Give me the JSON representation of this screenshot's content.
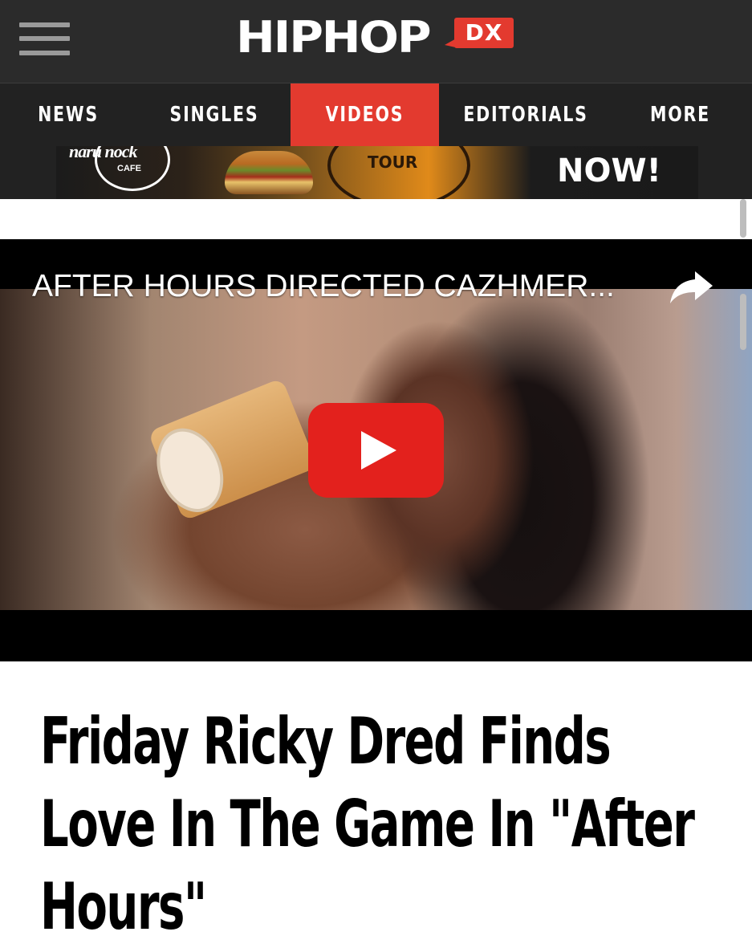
{
  "header": {
    "logo_main": "HIPHOP",
    "logo_badge": "DX",
    "menu_icon": "hamburger-menu-icon"
  },
  "nav": {
    "items": [
      {
        "label": "NEWS"
      },
      {
        "label": "SINGLES"
      },
      {
        "label": "VIDEOS",
        "active": true
      },
      {
        "label": "EDITORIALS"
      },
      {
        "label": "MORE"
      }
    ],
    "active_color": "#e33a2f"
  },
  "ad": {
    "brand_top": "naru nock",
    "brand_label": "CAFE",
    "tour_text": "TOUR",
    "cta": "NOW!"
  },
  "video": {
    "title": "AFTER HOURS DIRECTED CAZHMER...",
    "share_icon": "share-arrow-icon",
    "play_icon": "play-icon"
  },
  "article": {
    "title": "Friday Ricky Dred Finds Love In The Game In \"After Hours\""
  }
}
